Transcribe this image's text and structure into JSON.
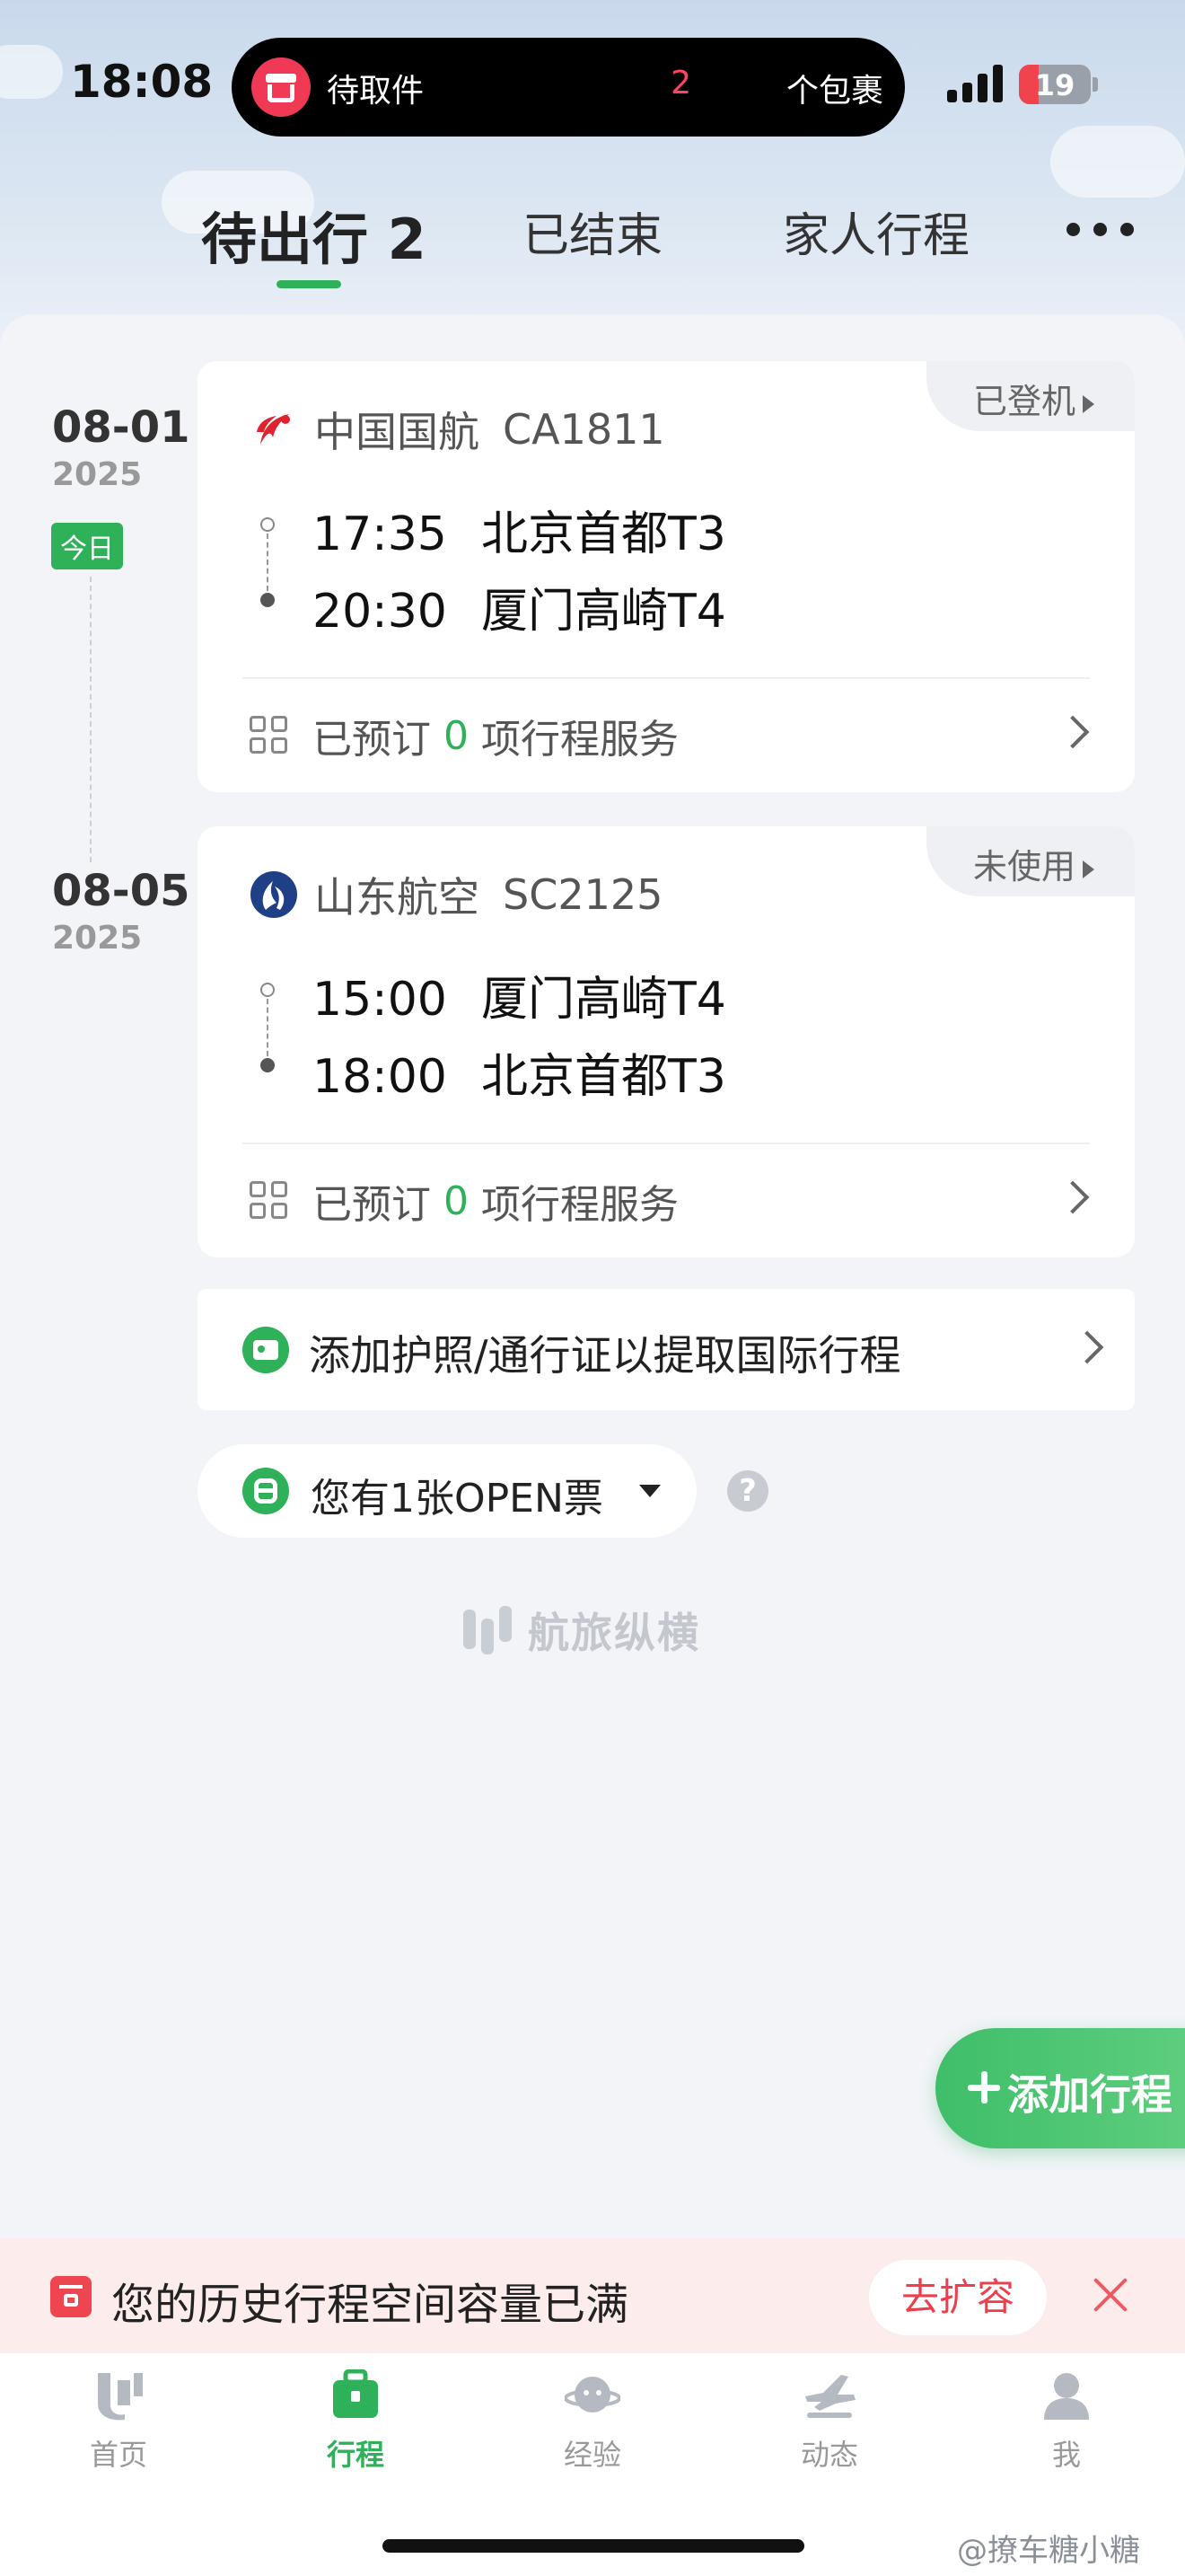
{
  "status_bar": {
    "time": "18:08",
    "island_label": "待取件",
    "island_count": "2",
    "island_unit": "个包裹",
    "battery": "19"
  },
  "tabs": [
    {
      "label": "待出行 2",
      "active": true
    },
    {
      "label": "已结束",
      "active": false
    },
    {
      "label": "家人行程",
      "active": false
    }
  ],
  "trips": [
    {
      "date": "08-01",
      "year": "2025",
      "badge": "今日",
      "status": "已登机",
      "airline": "中国国航",
      "flight_no": "CA1811",
      "depart_time": "17:35",
      "depart_airport": "北京首都T3",
      "arrive_time": "20:30",
      "arrive_airport": "厦门高崎T4",
      "service_prefix": "已预订",
      "service_count": "0",
      "service_suffix": "项行程服务"
    },
    {
      "date": "08-05",
      "year": "2025",
      "status": "未使用",
      "airline": "山东航空",
      "flight_no": "SC2125",
      "depart_time": "15:00",
      "depart_airport": "厦门高崎T4",
      "arrive_time": "18:00",
      "arrive_airport": "北京首都T3",
      "service_prefix": "已预订",
      "service_count": "0",
      "service_suffix": "项行程服务"
    }
  ],
  "passport_prompt": "添加护照/通行证以提取国际行程",
  "open_ticket": "您有1张OPEN票",
  "help_symbol": "?",
  "brand": "航旅纵横",
  "fab_label": "添加行程",
  "banner": {
    "text": "您的历史行程空间容量已满",
    "button": "去扩容"
  },
  "bottom_nav": [
    {
      "label": "首页",
      "icon": "home-icon"
    },
    {
      "label": "行程",
      "icon": "trip-icon",
      "active": true
    },
    {
      "label": "经验",
      "icon": "planet-icon"
    },
    {
      "label": "动态",
      "icon": "flight-status-icon"
    },
    {
      "label": "我",
      "icon": "profile-icon"
    }
  ],
  "watermark": "@撩车糖小糖",
  "colors": {
    "accent": "#2fb15a",
    "alert": "#ee3e4c",
    "airchina_red": "#e0242f",
    "shandong_blue": "#1f3f86"
  }
}
